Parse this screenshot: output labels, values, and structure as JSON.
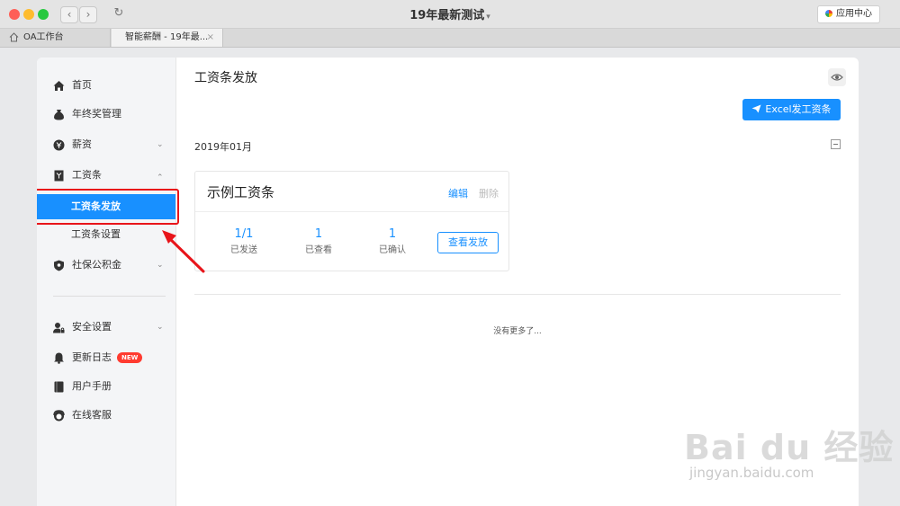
{
  "window": {
    "title": "19年最新测试",
    "title_caret": "▾",
    "app_center": "应用中心"
  },
  "tabs": [
    {
      "label": "OA工作台",
      "icon": "home-icon"
    },
    {
      "label": "智能薪酬 - 19年最...",
      "close": "×"
    }
  ],
  "nav": {
    "back": "‹",
    "forward": "›",
    "reload": "↻"
  },
  "sidebar": {
    "items": [
      {
        "label": "首页",
        "icon": "home-icon"
      },
      {
        "label": "年终奖管理",
        "icon": "money-bag-icon"
      },
      {
        "label": "薪资",
        "icon": "yen-coin-icon",
        "chevron": "⌄"
      },
      {
        "label": "工资条",
        "icon": "payslip-icon",
        "chevron": "⌃"
      },
      {
        "label": "工资条发放",
        "selected": true
      },
      {
        "label": "工资条设置"
      },
      {
        "label": "社保公积金",
        "icon": "shield-icon",
        "chevron": "⌄"
      },
      {
        "label": "安全设置",
        "icon": "user-lock-icon",
        "chevron": "⌄"
      },
      {
        "label": "更新日志",
        "icon": "bell-icon",
        "badge": "NEW"
      },
      {
        "label": "用户手册",
        "icon": "book-icon"
      },
      {
        "label": "在线客服",
        "icon": "headset-icon"
      }
    ]
  },
  "main": {
    "title": "工资条发放",
    "excel_button": "Excel发工资条",
    "month": "2019年01月",
    "card": {
      "title": "示例工资条",
      "edit": "编辑",
      "delete": "删除",
      "stats": [
        {
          "value": "1/1",
          "label": "已发送"
        },
        {
          "value": "1",
          "label": "已查看"
        },
        {
          "value": "1",
          "label": "已确认"
        }
      ],
      "view_button": "查看发放"
    },
    "no_more": "没有更多了..."
  },
  "watermark": {
    "brand": "Bai du 经验",
    "url": "jingyan.baidu.com"
  },
  "colors": {
    "accent": "#1890ff",
    "highlight": "#e8141a",
    "badge": "#ff3b30"
  }
}
